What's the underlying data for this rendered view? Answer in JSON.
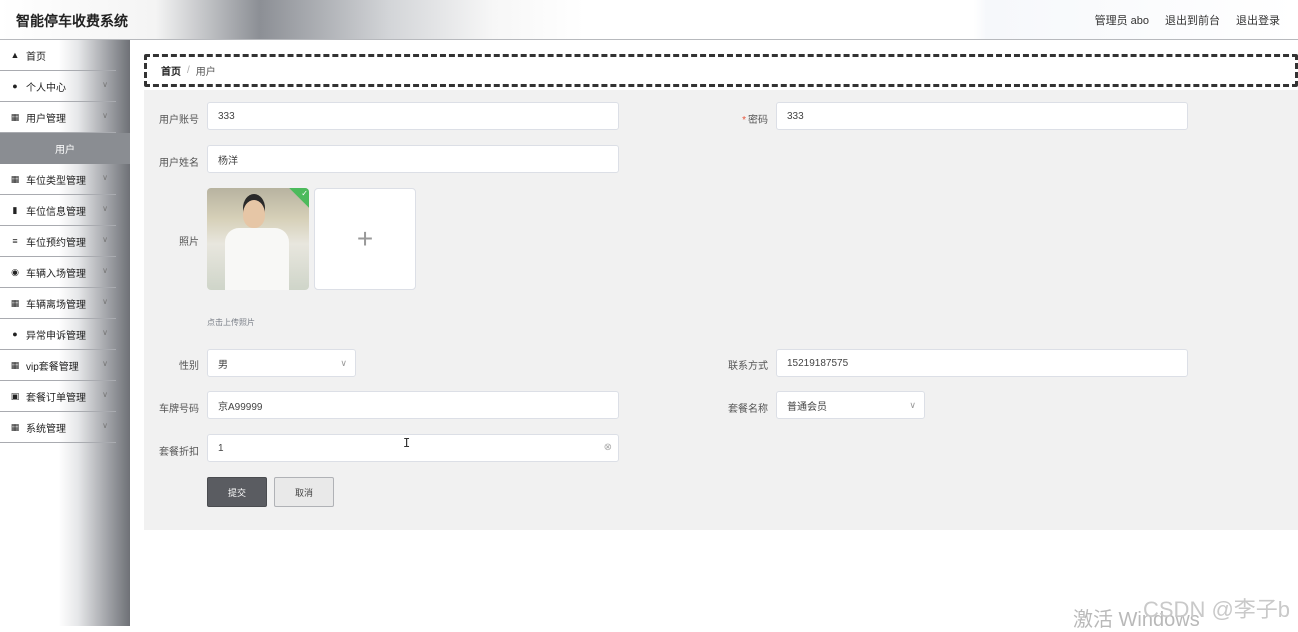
{
  "header": {
    "title": "智能停车收费系统",
    "user": "管理员 abo",
    "to_front": "退出到前台",
    "logout": "退出登录"
  },
  "sidebar": {
    "items": [
      {
        "label": "首页",
        "icon": "home-icon"
      },
      {
        "label": "个人中心",
        "icon": "user-icon"
      },
      {
        "label": "用户管理",
        "icon": "grid-icon"
      },
      {
        "label": "车位类型管理",
        "icon": "grid-icon"
      },
      {
        "label": "车位信息管理",
        "icon": "book-icon"
      },
      {
        "label": "车位预约管理",
        "icon": "sliders-icon"
      },
      {
        "label": "车辆入场管理",
        "icon": "pin-icon"
      },
      {
        "label": "车辆离场管理",
        "icon": "grid-icon"
      },
      {
        "label": "异常申诉管理",
        "icon": "user-icon"
      },
      {
        "label": "vip套餐管理",
        "icon": "grid-icon"
      },
      {
        "label": "套餐订单管理",
        "icon": "cart-icon"
      },
      {
        "label": "系统管理",
        "icon": "grid-icon"
      }
    ],
    "sub_item": "用户"
  },
  "breadcrumb": {
    "home": "首页",
    "sep": "/",
    "current": "用户"
  },
  "form": {
    "account_label": "用户账号",
    "account_value": "333",
    "password_label": "密码",
    "password_required": "*",
    "password_value": "333",
    "name_label": "用户姓名",
    "name_value": "杨洋",
    "photo_label": "照片",
    "photo_tip": "点击上传照片",
    "upload_plus": "+",
    "gender_label": "性别",
    "gender_value": "男",
    "contact_label": "联系方式",
    "contact_value": "15219187575",
    "plate_label": "车牌号码",
    "plate_value": "京A99999",
    "package_label": "套餐名称",
    "package_value": "普通会员",
    "discount_label": "套餐折扣",
    "discount_value": "1",
    "submit_label": "提交",
    "cancel_label": "取消"
  },
  "overlay": {
    "watermark": "激活 Windows",
    "csdn": "CSDN @李子b"
  }
}
